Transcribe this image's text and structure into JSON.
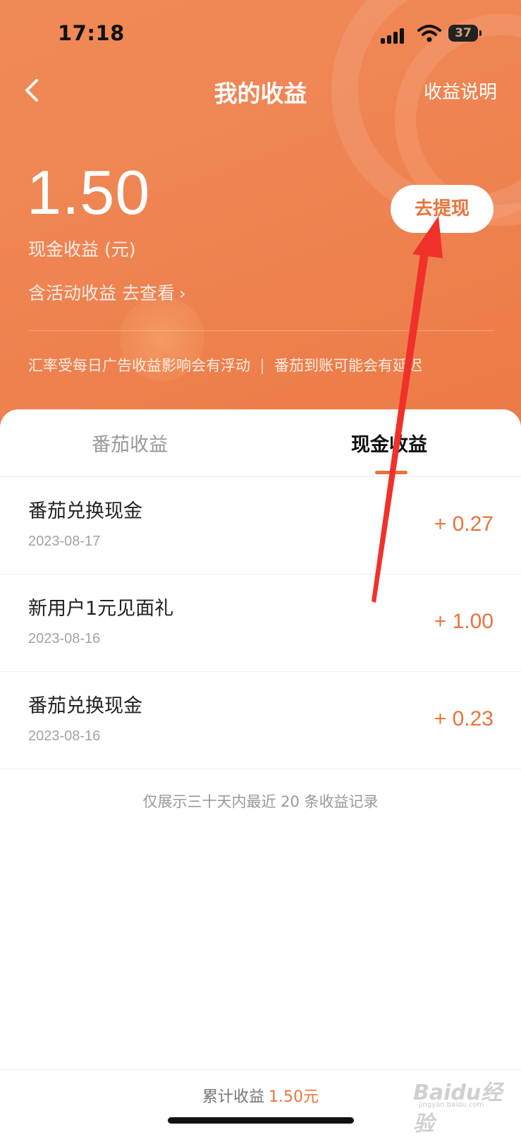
{
  "status_bar": {
    "time": "17:18",
    "battery": "37"
  },
  "nav": {
    "title": "我的收益",
    "right_link": "收益说明"
  },
  "balance": {
    "amount": "1.50",
    "label": "现金收益 (元)",
    "activity_link": "含活动收益 去查看",
    "withdraw_button": "去提现"
  },
  "notice": {
    "left": "汇率受每日广告收益影响会有浮动",
    "right": "番茄到账可能会有延迟"
  },
  "tabs": [
    {
      "label": "番茄收益",
      "active": false
    },
    {
      "label": "现金收益",
      "active": true
    }
  ],
  "records": [
    {
      "title": "番茄兑换现金",
      "date": "2023-08-17",
      "amount": "+ 0.27"
    },
    {
      "title": "新用户1元见面礼",
      "date": "2023-08-16",
      "amount": "+ 1.00"
    },
    {
      "title": "番茄兑换现金",
      "date": "2023-08-16",
      "amount": "+ 0.23"
    }
  ],
  "footnote": "仅展示三十天内最近 20 条收益记录",
  "bottom": {
    "total_label": "累计收益",
    "total_value": "1.50元"
  },
  "watermark": {
    "text": "Baidu经验",
    "sub": "jingyan.baidu.com"
  },
  "colors": {
    "header": "#ef8452",
    "accent": "#e8743c",
    "annotation_arrow": "#f0312a"
  }
}
